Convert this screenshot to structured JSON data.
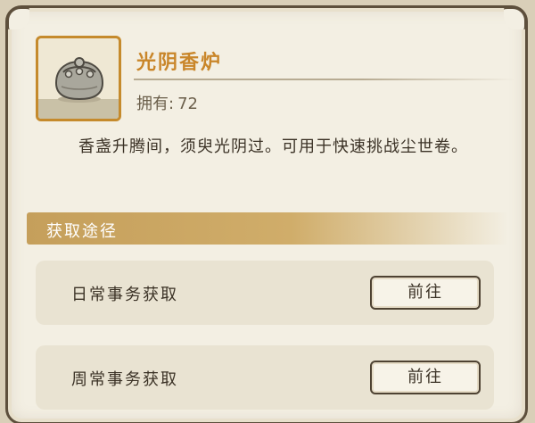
{
  "item": {
    "name": "光阴香炉",
    "owned_label": "拥有:",
    "owned_count": "72",
    "icon": "incense-burner-icon",
    "description": "香盏升腾间，须臾光阴过。可用于快速挑战尘世卷。"
  },
  "section": {
    "title": "获取途径"
  },
  "sources": [
    {
      "label": "日常事务获取",
      "button": "前往"
    },
    {
      "label": "周常事务获取",
      "button": "前往"
    }
  ],
  "colors": {
    "accent": "#c9862a",
    "frame": "#5d4f3c",
    "header_bar": "#c59f5b",
    "panel_bg": "#f3efe3"
  }
}
